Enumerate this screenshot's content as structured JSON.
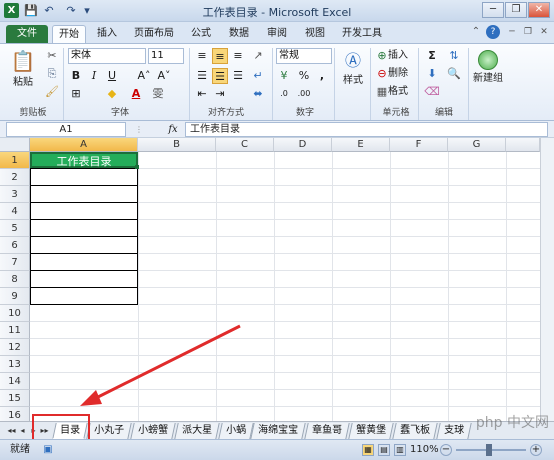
{
  "window": {
    "title": "工作表目录 - Microsoft Excel"
  },
  "quick_access": {
    "save": "💾",
    "undo": "↶",
    "redo": "↷",
    "customize": "▾"
  },
  "window_controls": {
    "minimize": "─",
    "restore": "❐",
    "close": "✕"
  },
  "ribbon_tabs": [
    {
      "label": "文件"
    },
    {
      "label": "开始"
    },
    {
      "label": "插入"
    },
    {
      "label": "页面布局"
    },
    {
      "label": "公式"
    },
    {
      "label": "数据"
    },
    {
      "label": "审阅"
    },
    {
      "label": "视图"
    },
    {
      "label": "开发工具"
    }
  ],
  "ribbon": {
    "clipboard": {
      "paste": "粘贴",
      "label": "剪贴板"
    },
    "font": {
      "name": "宋体",
      "size": "11",
      "bold": "B",
      "italic": "I",
      "underline": "U",
      "grow": "A˄",
      "shrink": "A˅",
      "label": "字体"
    },
    "alignment": {
      "label": "对齐方式"
    },
    "number": {
      "format": "常规",
      "percent": "%",
      "comma": ",",
      "label": "数字"
    },
    "styles": {
      "styles": "样式"
    },
    "cells": {
      "insert": "插入",
      "delete": "删除",
      "format": "格式",
      "label": "单元格"
    },
    "editing": {
      "sum": "Σ",
      "label": "编辑"
    },
    "newgroup": {
      "label": "新建组"
    }
  },
  "formula_bar": {
    "name_box": "A1",
    "fx": "fx",
    "value": "工作表目录"
  },
  "columns": [
    "A",
    "B",
    "C",
    "D",
    "E",
    "F",
    "G"
  ],
  "rows": [
    "1",
    "2",
    "3",
    "4",
    "5",
    "6",
    "7",
    "8",
    "9",
    "10",
    "11",
    "12",
    "13",
    "14",
    "15",
    "16",
    "17"
  ],
  "cells": {
    "A1": "工作表目录"
  },
  "sheet_tabs": [
    "目录",
    "小丸子",
    "小螃蟹",
    "派大星",
    "小蜗",
    "海绵宝宝",
    "章鱼哥",
    "蟹黄堡",
    "蠢飞板",
    "支球"
  ],
  "sheet_nav": [
    "◂◂",
    "◂",
    "▸",
    "▸▸"
  ],
  "status": {
    "ready": "就绪",
    "zoom": "110%"
  },
  "watermark": "php 中文网",
  "colors": {
    "file_tab": "#2a7a3e",
    "header_fill": "#24ad5a",
    "annotation": "#e02b2b"
  }
}
